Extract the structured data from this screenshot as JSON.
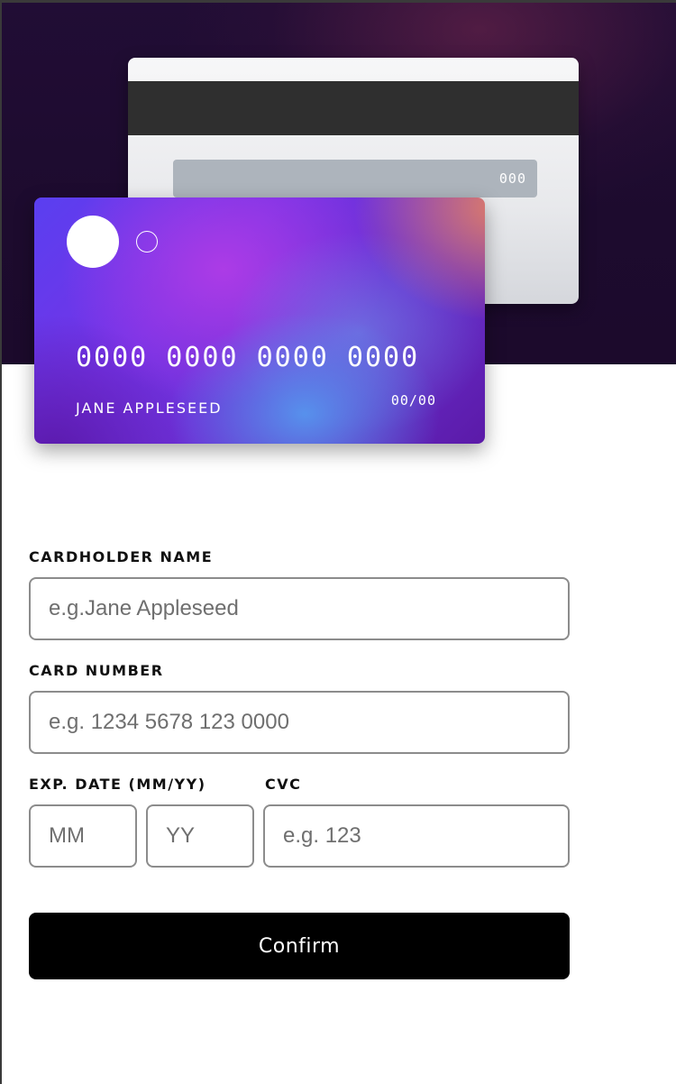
{
  "card_back": {
    "cvc": "000"
  },
  "card_front": {
    "number": "0000 0000 0000 0000",
    "holder": "JANE APPLESEED",
    "expiry": "00/00"
  },
  "form": {
    "cardholder_label": "CARDHOLDER NAME",
    "cardholder_placeholder": "e.g.Jane Appleseed",
    "number_label": "CARD NUMBER",
    "number_placeholder": "e.g. 1234 5678 123 0000",
    "exp_label": "EXP. DATE (MM/YY)",
    "month_placeholder": "MM",
    "year_placeholder": "YY",
    "cvc_label": "CVC",
    "cvc_placeholder": "e.g. 123",
    "confirm_label": "Confirm"
  },
  "colors": {
    "hero_background": "#1d0b2e",
    "button": "#000000",
    "input_border": "#8c8c8c"
  }
}
